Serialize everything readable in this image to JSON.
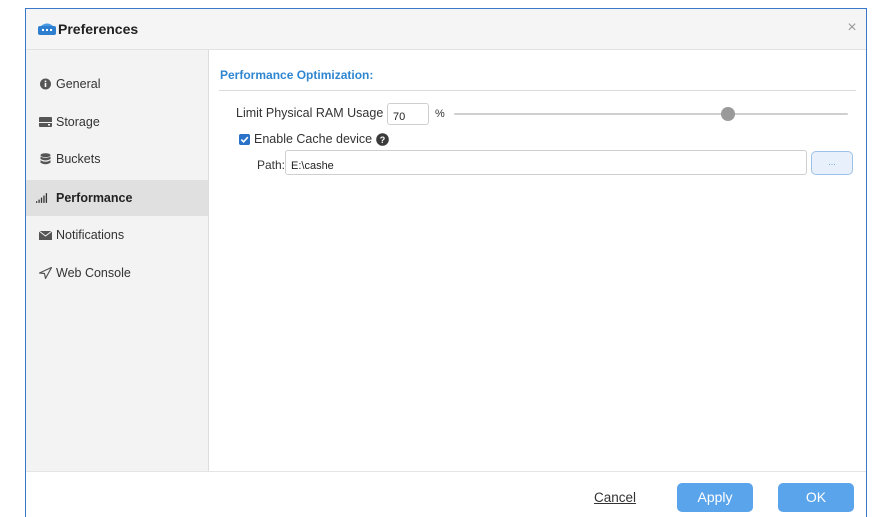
{
  "window": {
    "title": "Preferences",
    "close_glyph": "×",
    "app_icon": "toolbox-icon"
  },
  "sidebar": {
    "items": [
      {
        "label": "General",
        "icon": "info-icon",
        "active": false
      },
      {
        "label": "Storage",
        "icon": "hard-drive-icon",
        "active": false
      },
      {
        "label": "Buckets",
        "icon": "database-icon",
        "active": false
      },
      {
        "label": "Performance",
        "icon": "signal-bars-icon",
        "active": true
      },
      {
        "label": "Notifications",
        "icon": "envelope-icon",
        "active": false
      },
      {
        "label": "Web Console",
        "icon": "send-icon",
        "active": false
      }
    ]
  },
  "main": {
    "section_title": "Performance Optimization:",
    "ram": {
      "label": "Limit Physical RAM Usage",
      "value": "70",
      "unit": "%",
      "slider_level_percent": 70
    },
    "cache": {
      "label": "Enable Cache device",
      "checked": true,
      "help_icon": "question-circle-icon"
    },
    "path": {
      "label": "Path:",
      "value": "E:\\cashe",
      "browse_label": "..."
    }
  },
  "footer": {
    "cancel_label": "Cancel",
    "apply_label": "Apply",
    "ok_label": "OK"
  },
  "colors": {
    "accent": "#2f86d1",
    "button": "#5aa4ec",
    "sidebar_bg": "#f3f3f3",
    "sidebar_active": "#e0e0e0"
  }
}
